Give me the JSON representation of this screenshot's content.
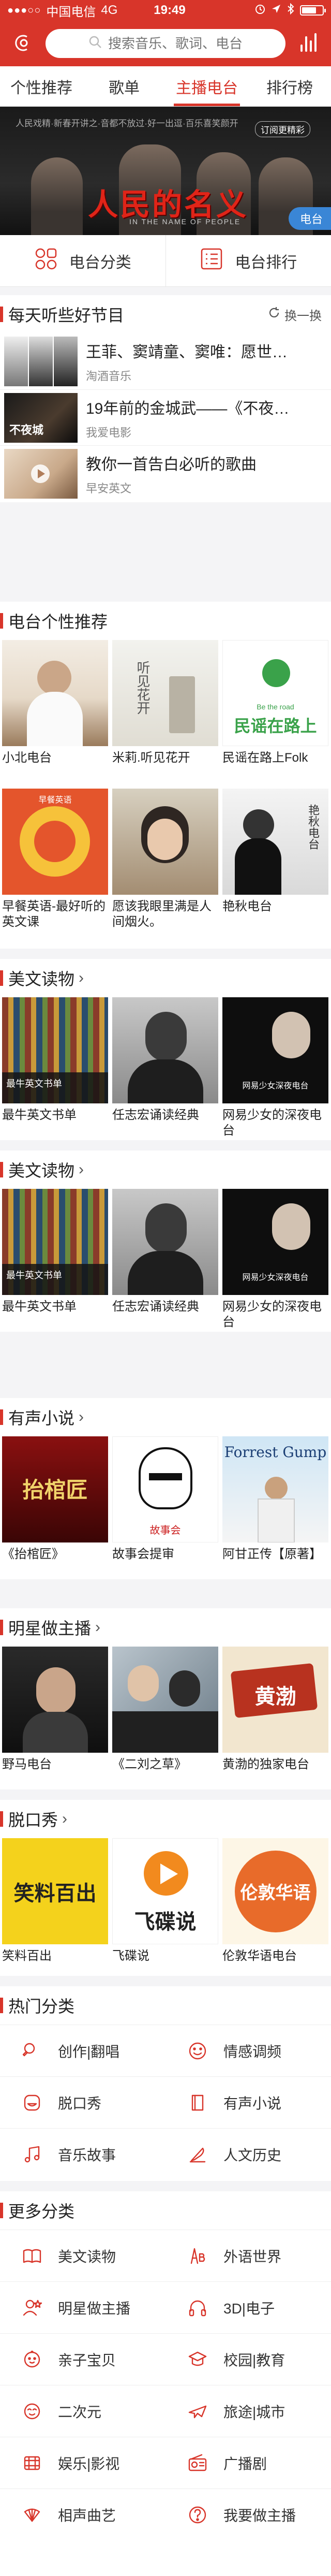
{
  "status_bar": {
    "dots": "●●●○○",
    "carrier": "中国电信",
    "network": "4G",
    "time": "19:49",
    "battery_level": 0.7
  },
  "search": {
    "placeholder": "搜索音乐、歌词、电台"
  },
  "tabs": [
    {
      "label": "个性推荐",
      "active": false
    },
    {
      "label": "歌单",
      "active": false
    },
    {
      "label": "主播电台",
      "active": true
    },
    {
      "label": "排行榜",
      "active": false
    }
  ],
  "banner": {
    "ticker": "人民戏精·新春开讲之·音都不放过·好一出逗·百乐喜笑颜开",
    "subscribe": "订阅更精彩",
    "title": "人民的名义",
    "caption": "IN THE NAME OF PEOPLE",
    "badge": "电台"
  },
  "quick": {
    "category": "电台分类",
    "ranking": "电台排行"
  },
  "daily": {
    "title": "每天听些好节目",
    "refresh": "换一换",
    "items": [
      {
        "title": "王菲、窦靖童、窦唯：愿世…",
        "source": "淘酒音乐"
      },
      {
        "title": "19年前的金城武——《不夜…",
        "source": "我爱电影"
      },
      {
        "title": "教你一首告白必听的歌曲",
        "source": "早安英文"
      }
    ]
  },
  "sections": {
    "personal": {
      "title": "电台个性推荐",
      "items": [
        {
          "label": "小北电台"
        },
        {
          "label": "米莉.听见花开"
        },
        {
          "label": "民谣在路上Folk"
        },
        {
          "label": "早餐英语-最好听的英文课"
        },
        {
          "label": "愿该我眼里满是人间烟火。"
        },
        {
          "label": "艳秋电台"
        }
      ]
    },
    "reading1": {
      "title": "美文读物",
      "items": [
        {
          "label": "最牛英文书单"
        },
        {
          "label": "任志宏诵读经典"
        },
        {
          "label": "网易少女的深夜电台"
        }
      ]
    },
    "reading2": {
      "title": "美文读物",
      "items": [
        {
          "label": "最牛英文书单"
        },
        {
          "label": "任志宏诵读经典"
        },
        {
          "label": "网易少女的深夜电台"
        }
      ]
    },
    "novel": {
      "title": "有声小说",
      "items": [
        {
          "label": "《抬棺匠》"
        },
        {
          "label": "故事会提审"
        },
        {
          "label": "阿甘正传【原著】"
        }
      ]
    },
    "celebrity": {
      "title": "明星做主播",
      "items": [
        {
          "label": "野马电台"
        },
        {
          "label": "《二刘之草》"
        },
        {
          "label": "黄渤的独家电台"
        }
      ]
    },
    "talkshow": {
      "title": "脱口秀",
      "items": [
        {
          "label": "笑料百出"
        },
        {
          "label": "飞碟说"
        },
        {
          "label": "伦敦华语电台"
        }
      ]
    }
  },
  "thumb_text": {
    "radio_tree": "听见花开",
    "folk_road": "民谣在路上",
    "folk_sub": "Be the road",
    "breakfast": "早餐英语",
    "yanqiu": "艳秋电台",
    "book_caption": "最牛英文书单",
    "night_radio": "网易少女深夜电台",
    "coffin": "抬棺匠",
    "story": "故事会",
    "forrest": "Forrest Gump",
    "herdman": "黄渤",
    "xiaoliao": "笑料百出",
    "feidie": "飞碟说",
    "london": "伦敦华语"
  },
  "hot_categories": {
    "title": "热门分类",
    "items": [
      {
        "label": "创作|翻唱",
        "icon": "microphone-icon"
      },
      {
        "label": "情感调频",
        "icon": "smile-icon"
      },
      {
        "label": "脱口秀",
        "icon": "laugh-icon"
      },
      {
        "label": "有声小说",
        "icon": "book-icon"
      },
      {
        "label": "音乐故事",
        "icon": "music-note-icon"
      },
      {
        "label": "人文历史",
        "icon": "quill-icon"
      }
    ]
  },
  "more_categories": {
    "title": "更多分类",
    "items": [
      {
        "label": "美文读物",
        "icon": "open-book-icon"
      },
      {
        "label": "外语世界",
        "icon": "abc-icon"
      },
      {
        "label": "明星做主播",
        "icon": "star-person-icon"
      },
      {
        "label": "3D|电子",
        "icon": "headphones-icon"
      },
      {
        "label": "亲子宝贝",
        "icon": "baby-icon"
      },
      {
        "label": "校园|教育",
        "icon": "school-icon"
      },
      {
        "label": "二次元",
        "icon": "anime-face-icon"
      },
      {
        "label": "旅途|城市",
        "icon": "airplane-icon"
      },
      {
        "label": "娱乐|影视",
        "icon": "film-icon"
      },
      {
        "label": "广播剧",
        "icon": "radio-icon"
      },
      {
        "label": "相声曲艺",
        "icon": "fan-icon"
      },
      {
        "label": "我要做主播",
        "icon": "question-icon"
      }
    ]
  },
  "colors": {
    "accent": "#d8352a",
    "text": "#222222",
    "muted": "#888888",
    "badge_blue": "#3a86d6"
  }
}
